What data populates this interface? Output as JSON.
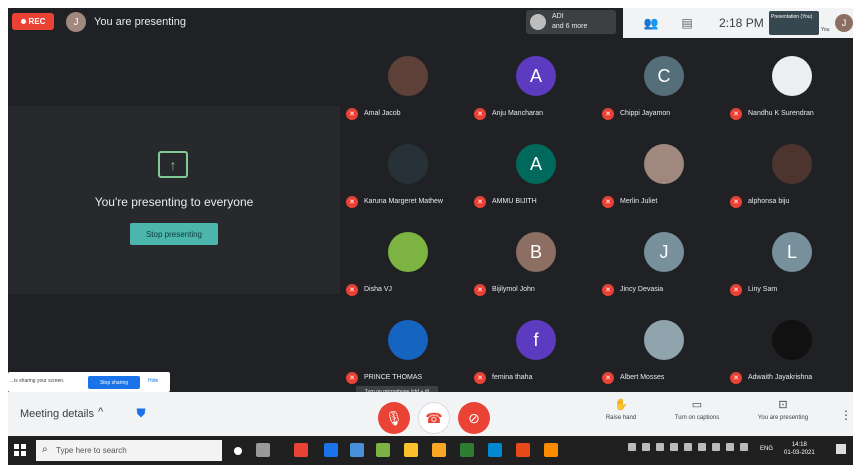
{
  "meet": {
    "rec_label": "REC",
    "presenter_initial": "J",
    "presenting_title": "You are presenting",
    "adi_chip": {
      "name": "ADI",
      "more": "and 6 more"
    },
    "clock": "2:18 PM",
    "pres_thumb_text": "Presentation (You)",
    "you_text": "You",
    "self_initial": "J"
  },
  "present_panel": {
    "message": "You're presenting to everyone",
    "stop_label": "Stop presenting"
  },
  "participants": [
    {
      "name": "Amal Jacob",
      "initial": "",
      "color": "#5d4037"
    },
    {
      "name": "Anju Mancharan",
      "initial": "A",
      "color": "#5c3bc0"
    },
    {
      "name": "Chippi Jayamon",
      "initial": "C",
      "color": "#546e7a"
    },
    {
      "name": "Nandhu K Surendran",
      "initial": "",
      "color": "#eceff1"
    },
    {
      "name": "Karuna Margeret Mathew",
      "initial": "",
      "color": "#263238"
    },
    {
      "name": "AMMU BIJITH",
      "initial": "A",
      "color": "#00695c"
    },
    {
      "name": "Merlin Juliet",
      "initial": "",
      "color": "#a1887f"
    },
    {
      "name": "alphonsa biju",
      "initial": "",
      "color": "#4e342e"
    },
    {
      "name": "Disha VJ",
      "initial": "",
      "color": "#7cb342"
    },
    {
      "name": "Bijilymol John",
      "initial": "B",
      "color": "#8d6e63"
    },
    {
      "name": "Jincy Devasia",
      "initial": "J",
      "color": "#78909c"
    },
    {
      "name": "Liny Sam",
      "initial": "L",
      "color": "#78909c"
    },
    {
      "name": "PRINCE THOMAS",
      "initial": "",
      "color": "#1565c0"
    },
    {
      "name": "femina thaha",
      "initial": "f",
      "color": "#5c3bc0"
    },
    {
      "name": "Albert Mosses",
      "initial": "",
      "color": "#90a4ae"
    },
    {
      "name": "Adwaith Jayakrishna",
      "initial": "",
      "color": "#111111"
    }
  ],
  "sharing_bar": {
    "text": "...is sharing your screen.",
    "stop_label": "Stop sharing",
    "hide_label": "Hide"
  },
  "mic_tooltip": "Turn on microphone (ctrl + d)",
  "bottom": {
    "meeting_details": "Meeting details",
    "raise_hand": "Raise hand",
    "captions": "Turn on captions",
    "presenting": "You are presenting"
  },
  "taskbar": {
    "search_placeholder": "Type here to search",
    "lang": "ENG",
    "time": "14:18",
    "date": "01-03-2021"
  }
}
